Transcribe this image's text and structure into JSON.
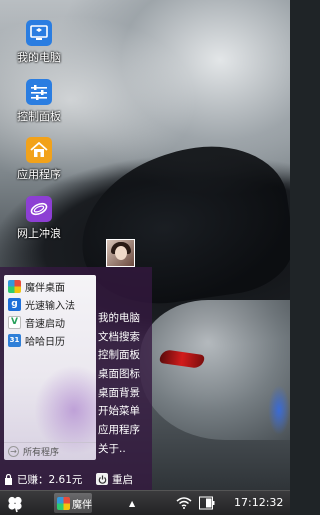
{
  "desktop": {
    "icons": [
      {
        "label": "我的电脑",
        "icon": "computer-icon"
      },
      {
        "label": "控制面板",
        "icon": "control-panel-icon"
      },
      {
        "label": "应用程序",
        "icon": "home-apps-icon"
      },
      {
        "label": "网上冲浪",
        "icon": "globe-browser-icon"
      }
    ]
  },
  "start_menu": {
    "apps": [
      {
        "label": "魔伴桌面",
        "icon": "moban-icon"
      },
      {
        "label": "光速输入法",
        "icon": "ime-icon"
      },
      {
        "label": "音速启动",
        "icon": "launcher-icon"
      },
      {
        "label": "哈哈日历",
        "icon": "calendar-icon"
      }
    ],
    "all_programs": "所有程序",
    "right_items": [
      "我的电脑",
      "文档搜索",
      "控制面板",
      "桌面图标",
      "桌面背景",
      "开始菜单",
      "应用程序",
      "关于.."
    ],
    "earned": "已赚：2.61元",
    "restart": "重启"
  },
  "taskbar": {
    "app_label": "魔伴",
    "clock": "17:12:32"
  },
  "colors": {
    "menu_bg": "#341840",
    "taskbar_bg": "#2a2a2b",
    "icon_blue": "#2a7de1",
    "icon_orange": "#f2a21a",
    "icon_purple": "#8d3fd4"
  }
}
